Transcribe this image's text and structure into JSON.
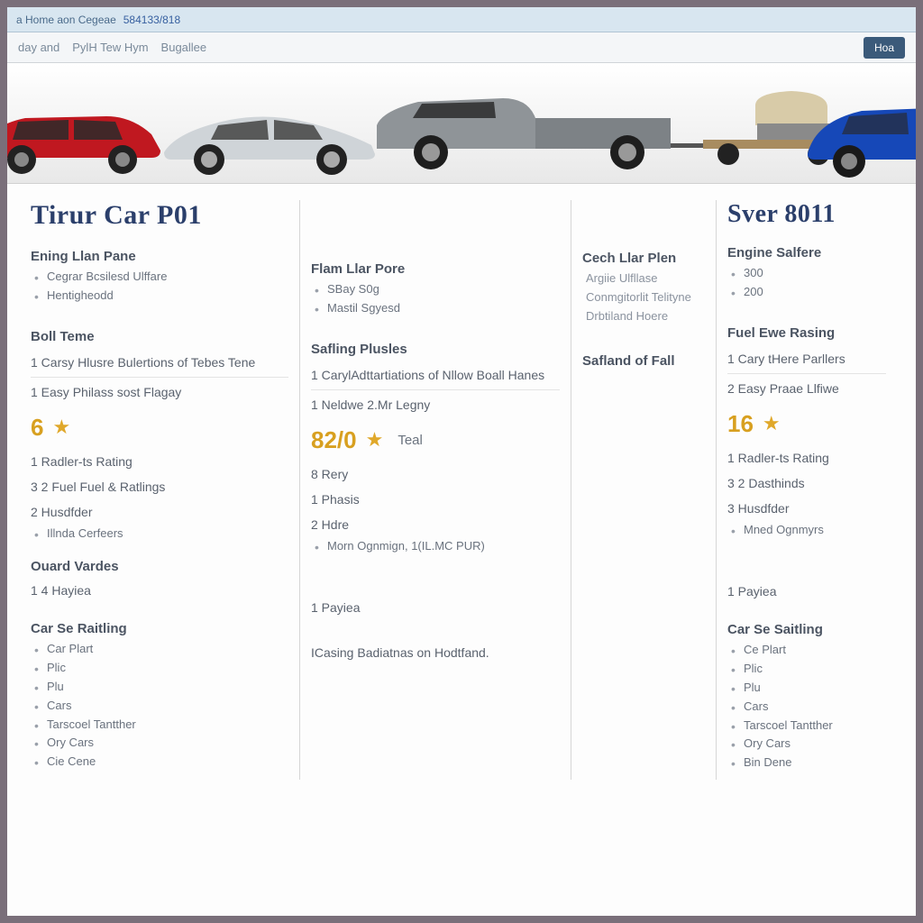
{
  "chrome": {
    "title": "a Home aon Cegeae",
    "address": "584133/818"
  },
  "nav": {
    "item1": "day and",
    "item2": "PylH Tew Hym",
    "item3": "Bugallee",
    "button": "Hoa"
  },
  "left_model_title": "Tirur Car P01",
  "right_model_title": "Sver 8011",
  "col1": {
    "sec1_h": "Ening Llan Pane",
    "sec1_i1": "Cegrar Bcsilesd Ulffare",
    "sec1_i2": "Hentigheodd",
    "sec2_h": "Boll Teme",
    "line1": "1 Carsy Hlusre Bulertions of Tebes Tene",
    "line2": "1 Easy Philass sost Flagay",
    "rating_num": "6",
    "line3": "1 Radler-ts Rating",
    "line4": "3 2 Fuel Fuel & Ratlings",
    "line5": "2 Husdfder",
    "line5_sub": "Illnda Cerfeers",
    "sec3_h": "Ouard Vardes",
    "line6": "1 4 Hayiea",
    "sec4_h": "Car Se Raitling",
    "s4_i1": "Car Plart",
    "s4_i2": "Plic",
    "s4_i3": "Plu",
    "s4_i4": "Cars",
    "s4_i5": "Tarscoel Tantther",
    "s4_i6": "Ory Cars",
    "s4_i7": "Cie Cene"
  },
  "col2": {
    "sec1_h": "Flam Llar Pore",
    "sec1_i1": "SBay S0g",
    "sec1_i2": "Mastil Sgyesd",
    "sec2_h": "Safling Plusles",
    "line1": "1 CarylAdttartiations of Nllow Boall Hanes",
    "line2": "1 Neldwe 2.Mr Legny",
    "rating_num": "82/0",
    "rating_tag": "Teal",
    "line3": "8 Rery",
    "line4": "1 Phasis",
    "line5": "2 Hdre",
    "line5_sub": "Morn Ognmign, 1(IL.MC PUR)",
    "line6": "1 Payiea",
    "line7": "ICasing Badiatnas on Hodtfand."
  },
  "col3": {
    "sec1_h": "Cech Llar Plen",
    "sec1_l1": "Argiie Ulfllase",
    "sec1_l2": "Conmgitorlit Telityne",
    "sec1_l3": "Drbtiland Hoere",
    "sec2_h": "Safland of Fall"
  },
  "col4": {
    "sec1_h": "Engine Salfere",
    "sec1_i1": "300",
    "sec1_i2": "200",
    "sec2_h": "Fuel Ewe Rasing",
    "line1": "1 Cary tHere Parllers",
    "line2": "2 Easy Praae Llfiwe",
    "rating_num": "16",
    "line3": "1 Radler-ts Rating",
    "line4": "3 2 Dasthinds",
    "line5": "3 Husdfder",
    "line5_sub": "Mned Ognmyrs",
    "line6": "1 Payiea",
    "sec4_h": "Car Se Saitling",
    "s4_i1": "Ce Plart",
    "s4_i2": "Plic",
    "s4_i3": "Plu",
    "s4_i4": "Cars",
    "s4_i5": "Tarscoel Tantther",
    "s4_i6": "Ory Cars",
    "s4_i7": "Bin Dene"
  }
}
